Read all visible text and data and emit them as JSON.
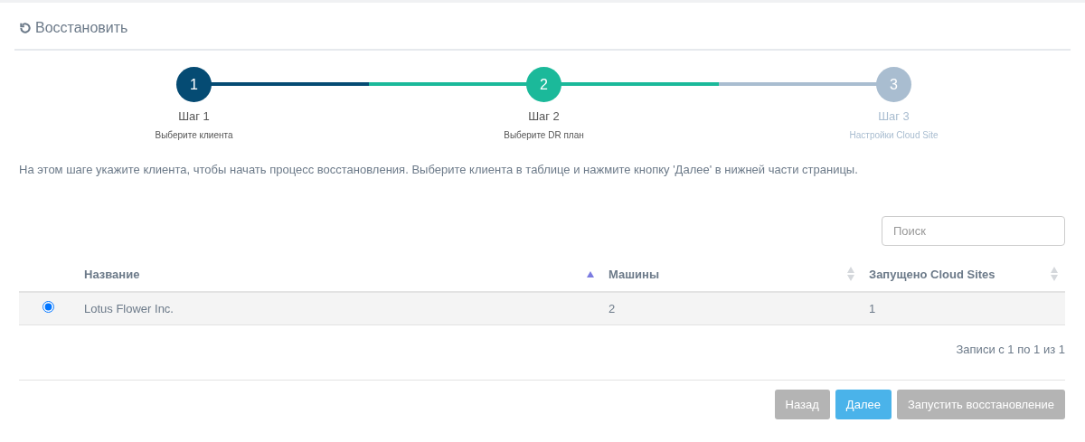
{
  "header": {
    "title": "Восстановить"
  },
  "steps": [
    {
      "number": "1",
      "title": "Шаг 1",
      "subtitle": "Выберите клиента",
      "completed": true,
      "active": false
    },
    {
      "number": "2",
      "title": "Шаг 2",
      "subtitle": "Выберите DR план",
      "completed": false,
      "active": true
    },
    {
      "number": "3",
      "title": "Шаг 3",
      "subtitle": "Настройки Cloud Site",
      "completed": false,
      "active": false
    }
  ],
  "description": "На этом шаге укажите клиента, чтобы начать процесс восстановления. Выберите клиента в таблице и нажмите кнопку 'Далее' в нижней части страницы.",
  "search": {
    "placeholder": "Поиск"
  },
  "table": {
    "columns": [
      {
        "label": "Название",
        "sorted": true
      },
      {
        "label": "Машины",
        "sorted": false
      },
      {
        "label": "Запущено Cloud Sites",
        "sorted": false
      }
    ],
    "rows": [
      {
        "selected": true,
        "cells": [
          "Lotus Flower Inc.",
          "2",
          "1"
        ]
      }
    ]
  },
  "info": "Записи с 1 по 1 из 1",
  "buttons": [
    {
      "label": "Назад",
      "kind": "secondary",
      "disabled": true
    },
    {
      "label": "Далее",
      "kind": "primary",
      "disabled": false
    },
    {
      "label": "Запустить восстановление",
      "kind": "secondary",
      "disabled": true
    }
  ]
}
